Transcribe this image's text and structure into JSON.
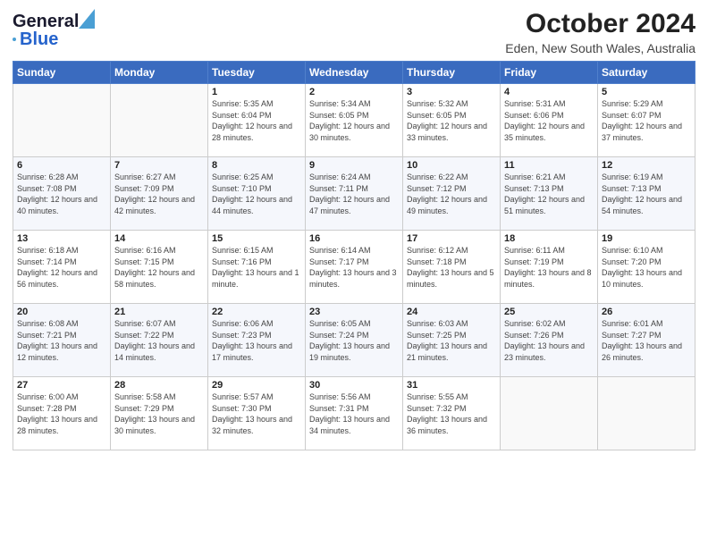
{
  "logo": {
    "line1": "General",
    "line2": "Blue"
  },
  "header": {
    "month": "October 2024",
    "location": "Eden, New South Wales, Australia"
  },
  "weekdays": [
    "Sunday",
    "Monday",
    "Tuesday",
    "Wednesday",
    "Thursday",
    "Friday",
    "Saturday"
  ],
  "weeks": [
    [
      {
        "day": "",
        "sunrise": "",
        "sunset": "",
        "daylight": ""
      },
      {
        "day": "",
        "sunrise": "",
        "sunset": "",
        "daylight": ""
      },
      {
        "day": "1",
        "sunrise": "Sunrise: 5:35 AM",
        "sunset": "Sunset: 6:04 PM",
        "daylight": "Daylight: 12 hours and 28 minutes."
      },
      {
        "day": "2",
        "sunrise": "Sunrise: 5:34 AM",
        "sunset": "Sunset: 6:05 PM",
        "daylight": "Daylight: 12 hours and 30 minutes."
      },
      {
        "day": "3",
        "sunrise": "Sunrise: 5:32 AM",
        "sunset": "Sunset: 6:05 PM",
        "daylight": "Daylight: 12 hours and 33 minutes."
      },
      {
        "day": "4",
        "sunrise": "Sunrise: 5:31 AM",
        "sunset": "Sunset: 6:06 PM",
        "daylight": "Daylight: 12 hours and 35 minutes."
      },
      {
        "day": "5",
        "sunrise": "Sunrise: 5:29 AM",
        "sunset": "Sunset: 6:07 PM",
        "daylight": "Daylight: 12 hours and 37 minutes."
      }
    ],
    [
      {
        "day": "6",
        "sunrise": "Sunrise: 6:28 AM",
        "sunset": "Sunset: 7:08 PM",
        "daylight": "Daylight: 12 hours and 40 minutes."
      },
      {
        "day": "7",
        "sunrise": "Sunrise: 6:27 AM",
        "sunset": "Sunset: 7:09 PM",
        "daylight": "Daylight: 12 hours and 42 minutes."
      },
      {
        "day": "8",
        "sunrise": "Sunrise: 6:25 AM",
        "sunset": "Sunset: 7:10 PM",
        "daylight": "Daylight: 12 hours and 44 minutes."
      },
      {
        "day": "9",
        "sunrise": "Sunrise: 6:24 AM",
        "sunset": "Sunset: 7:11 PM",
        "daylight": "Daylight: 12 hours and 47 minutes."
      },
      {
        "day": "10",
        "sunrise": "Sunrise: 6:22 AM",
        "sunset": "Sunset: 7:12 PM",
        "daylight": "Daylight: 12 hours and 49 minutes."
      },
      {
        "day": "11",
        "sunrise": "Sunrise: 6:21 AM",
        "sunset": "Sunset: 7:13 PM",
        "daylight": "Daylight: 12 hours and 51 minutes."
      },
      {
        "day": "12",
        "sunrise": "Sunrise: 6:19 AM",
        "sunset": "Sunset: 7:13 PM",
        "daylight": "Daylight: 12 hours and 54 minutes."
      }
    ],
    [
      {
        "day": "13",
        "sunrise": "Sunrise: 6:18 AM",
        "sunset": "Sunset: 7:14 PM",
        "daylight": "Daylight: 12 hours and 56 minutes."
      },
      {
        "day": "14",
        "sunrise": "Sunrise: 6:16 AM",
        "sunset": "Sunset: 7:15 PM",
        "daylight": "Daylight: 12 hours and 58 minutes."
      },
      {
        "day": "15",
        "sunrise": "Sunrise: 6:15 AM",
        "sunset": "Sunset: 7:16 PM",
        "daylight": "Daylight: 13 hours and 1 minute."
      },
      {
        "day": "16",
        "sunrise": "Sunrise: 6:14 AM",
        "sunset": "Sunset: 7:17 PM",
        "daylight": "Daylight: 13 hours and 3 minutes."
      },
      {
        "day": "17",
        "sunrise": "Sunrise: 6:12 AM",
        "sunset": "Sunset: 7:18 PM",
        "daylight": "Daylight: 13 hours and 5 minutes."
      },
      {
        "day": "18",
        "sunrise": "Sunrise: 6:11 AM",
        "sunset": "Sunset: 7:19 PM",
        "daylight": "Daylight: 13 hours and 8 minutes."
      },
      {
        "day": "19",
        "sunrise": "Sunrise: 6:10 AM",
        "sunset": "Sunset: 7:20 PM",
        "daylight": "Daylight: 13 hours and 10 minutes."
      }
    ],
    [
      {
        "day": "20",
        "sunrise": "Sunrise: 6:08 AM",
        "sunset": "Sunset: 7:21 PM",
        "daylight": "Daylight: 13 hours and 12 minutes."
      },
      {
        "day": "21",
        "sunrise": "Sunrise: 6:07 AM",
        "sunset": "Sunset: 7:22 PM",
        "daylight": "Daylight: 13 hours and 14 minutes."
      },
      {
        "day": "22",
        "sunrise": "Sunrise: 6:06 AM",
        "sunset": "Sunset: 7:23 PM",
        "daylight": "Daylight: 13 hours and 17 minutes."
      },
      {
        "day": "23",
        "sunrise": "Sunrise: 6:05 AM",
        "sunset": "Sunset: 7:24 PM",
        "daylight": "Daylight: 13 hours and 19 minutes."
      },
      {
        "day": "24",
        "sunrise": "Sunrise: 6:03 AM",
        "sunset": "Sunset: 7:25 PM",
        "daylight": "Daylight: 13 hours and 21 minutes."
      },
      {
        "day": "25",
        "sunrise": "Sunrise: 6:02 AM",
        "sunset": "Sunset: 7:26 PM",
        "daylight": "Daylight: 13 hours and 23 minutes."
      },
      {
        "day": "26",
        "sunrise": "Sunrise: 6:01 AM",
        "sunset": "Sunset: 7:27 PM",
        "daylight": "Daylight: 13 hours and 26 minutes."
      }
    ],
    [
      {
        "day": "27",
        "sunrise": "Sunrise: 6:00 AM",
        "sunset": "Sunset: 7:28 PM",
        "daylight": "Daylight: 13 hours and 28 minutes."
      },
      {
        "day": "28",
        "sunrise": "Sunrise: 5:58 AM",
        "sunset": "Sunset: 7:29 PM",
        "daylight": "Daylight: 13 hours and 30 minutes."
      },
      {
        "day": "29",
        "sunrise": "Sunrise: 5:57 AM",
        "sunset": "Sunset: 7:30 PM",
        "daylight": "Daylight: 13 hours and 32 minutes."
      },
      {
        "day": "30",
        "sunrise": "Sunrise: 5:56 AM",
        "sunset": "Sunset: 7:31 PM",
        "daylight": "Daylight: 13 hours and 34 minutes."
      },
      {
        "day": "31",
        "sunrise": "Sunrise: 5:55 AM",
        "sunset": "Sunset: 7:32 PM",
        "daylight": "Daylight: 13 hours and 36 minutes."
      },
      {
        "day": "",
        "sunrise": "",
        "sunset": "",
        "daylight": ""
      },
      {
        "day": "",
        "sunrise": "",
        "sunset": "",
        "daylight": ""
      }
    ]
  ]
}
